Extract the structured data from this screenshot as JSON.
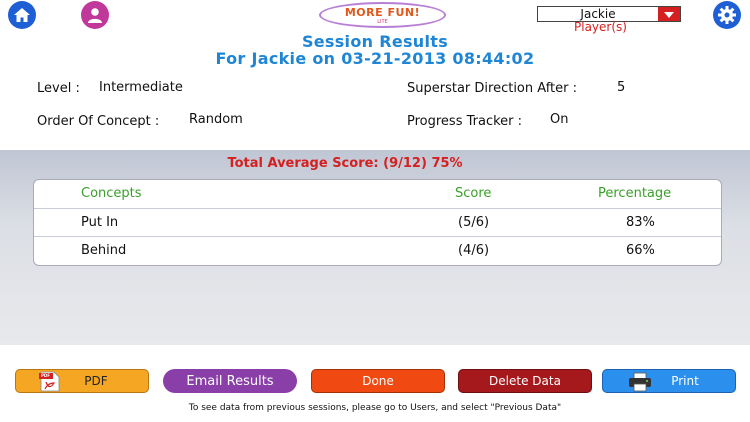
{
  "header": {
    "logo_line1": "MORE FUN!",
    "logo_line2": "LITE",
    "player_name": "Jackie",
    "player_label": "Player(s)",
    "title": "Session Results",
    "subtitle": "For Jackie on 03-21-2013 08:44:02"
  },
  "settings": {
    "level_label": "Level :",
    "level_value": "Intermediate",
    "superstar_label": "Superstar Direction After :",
    "superstar_value": "5",
    "order_label": "Order Of Concept :",
    "order_value": "Random",
    "progress_label": "Progress Tracker :",
    "progress_value": "On"
  },
  "results": {
    "total": "Total Average Score: (9/12) 75%",
    "columns": [
      "Concepts",
      "Score",
      "Percentage"
    ],
    "rows": [
      {
        "concept": "Put In",
        "score": "(5/6)",
        "percentage": "83%"
      },
      {
        "concept": "Behind",
        "score": "(4/6)",
        "percentage": "66%"
      }
    ]
  },
  "buttons": {
    "pdf": "PDF",
    "email": "Email Results",
    "done": "Done",
    "delete": "Delete Data",
    "print": "Print",
    "pdf_icon_text": "PDF"
  },
  "footer": "To see data from previous sessions, please go to Users, and select \"Previous Data\"",
  "colors": {
    "title_blue": "#1f86d6",
    "score_red": "#d42020",
    "header_green": "#3aa02a"
  },
  "icons": [
    "home-icon",
    "user-icon",
    "gear-icon",
    "dropdown-arrow-icon",
    "pdf-icon",
    "printer-icon"
  ]
}
